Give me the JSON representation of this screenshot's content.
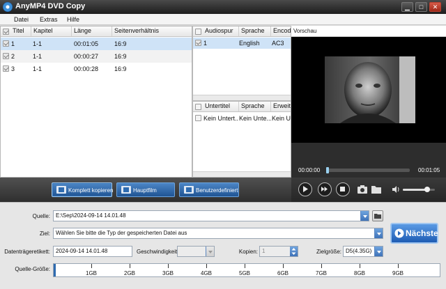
{
  "window": {
    "title": "AnyMP4 DVD Copy"
  },
  "menu": [
    "Datei",
    "Extras",
    "Hilfe"
  ],
  "titles_table": {
    "headers": [
      "Titel",
      "Kapitel",
      "Länge",
      "Seitenverhältnis"
    ],
    "rows": [
      {
        "num": "1",
        "chapter": "1-1",
        "length": "00:01:05",
        "ratio": "16:9",
        "selected": true
      },
      {
        "num": "2",
        "chapter": "1-1",
        "length": "00:00:27",
        "ratio": "16:9",
        "selected": false
      },
      {
        "num": "3",
        "chapter": "1-1",
        "length": "00:00:28",
        "ratio": "16:9",
        "selected": false
      }
    ]
  },
  "audio_table": {
    "headers": [
      "Audiospur",
      "Sprache",
      "Encode"
    ],
    "rows": [
      {
        "num": "1",
        "language": "English",
        "encoder": "AC3"
      }
    ]
  },
  "subtitle_table": {
    "headers": [
      "Untertitel",
      "Sprache",
      "Erweite"
    ],
    "rows": [
      {
        "name": "Kein Untert...",
        "language": "Kein Unte...",
        "extended": "Kein Un"
      }
    ]
  },
  "preview": {
    "label": "Vorschau",
    "current_time": "00:00:00",
    "total_time": "00:01:05",
    "progress": 0.0,
    "volume": 0.75
  },
  "modes": {
    "full": "Komplett kopieren",
    "main": "Hauptfilm",
    "custom": "Benutzerdefiniert"
  },
  "form": {
    "source_label": "Quelle:",
    "source_value": "E:\\Sep\\2024-09-14 14.01.48",
    "target_label": "Ziel:",
    "target_value": "Wählen Sie bitte die Typ der gespeicherten Datei aus",
    "disc_label_label": "Datenträgeretikett:",
    "disc_label_value": "2024-09-14 14.01.48",
    "speed_label": "Geschwindigkeit:",
    "speed_value": "",
    "copies_label": "Kopien:",
    "copies_value": "1",
    "target_size_label": "Zielgröße:",
    "target_size_value": "D5(4.35G)",
    "source_size_label": "Quelle-Größe:"
  },
  "next_button": "Nächste",
  "size_ticks": [
    "1GB",
    "2GB",
    "3GB",
    "4GB",
    "5GB",
    "6GB",
    "7GB",
    "8GB",
    "9GB"
  ],
  "icons": {
    "app": "disc-logo-icon",
    "minimize": "minimize-icon",
    "maximize": "maximize-icon",
    "close": "close-icon",
    "play": "play-icon",
    "fast_forward": "fast-forward-icon",
    "stop": "stop-icon",
    "snapshot": "camera-icon",
    "folder": "folder-icon",
    "volume": "speaker-icon"
  },
  "colors": {
    "accent": "#2e6bb0",
    "selected_row": "#cfe3f7",
    "titlebar": "#2a2a2a"
  }
}
